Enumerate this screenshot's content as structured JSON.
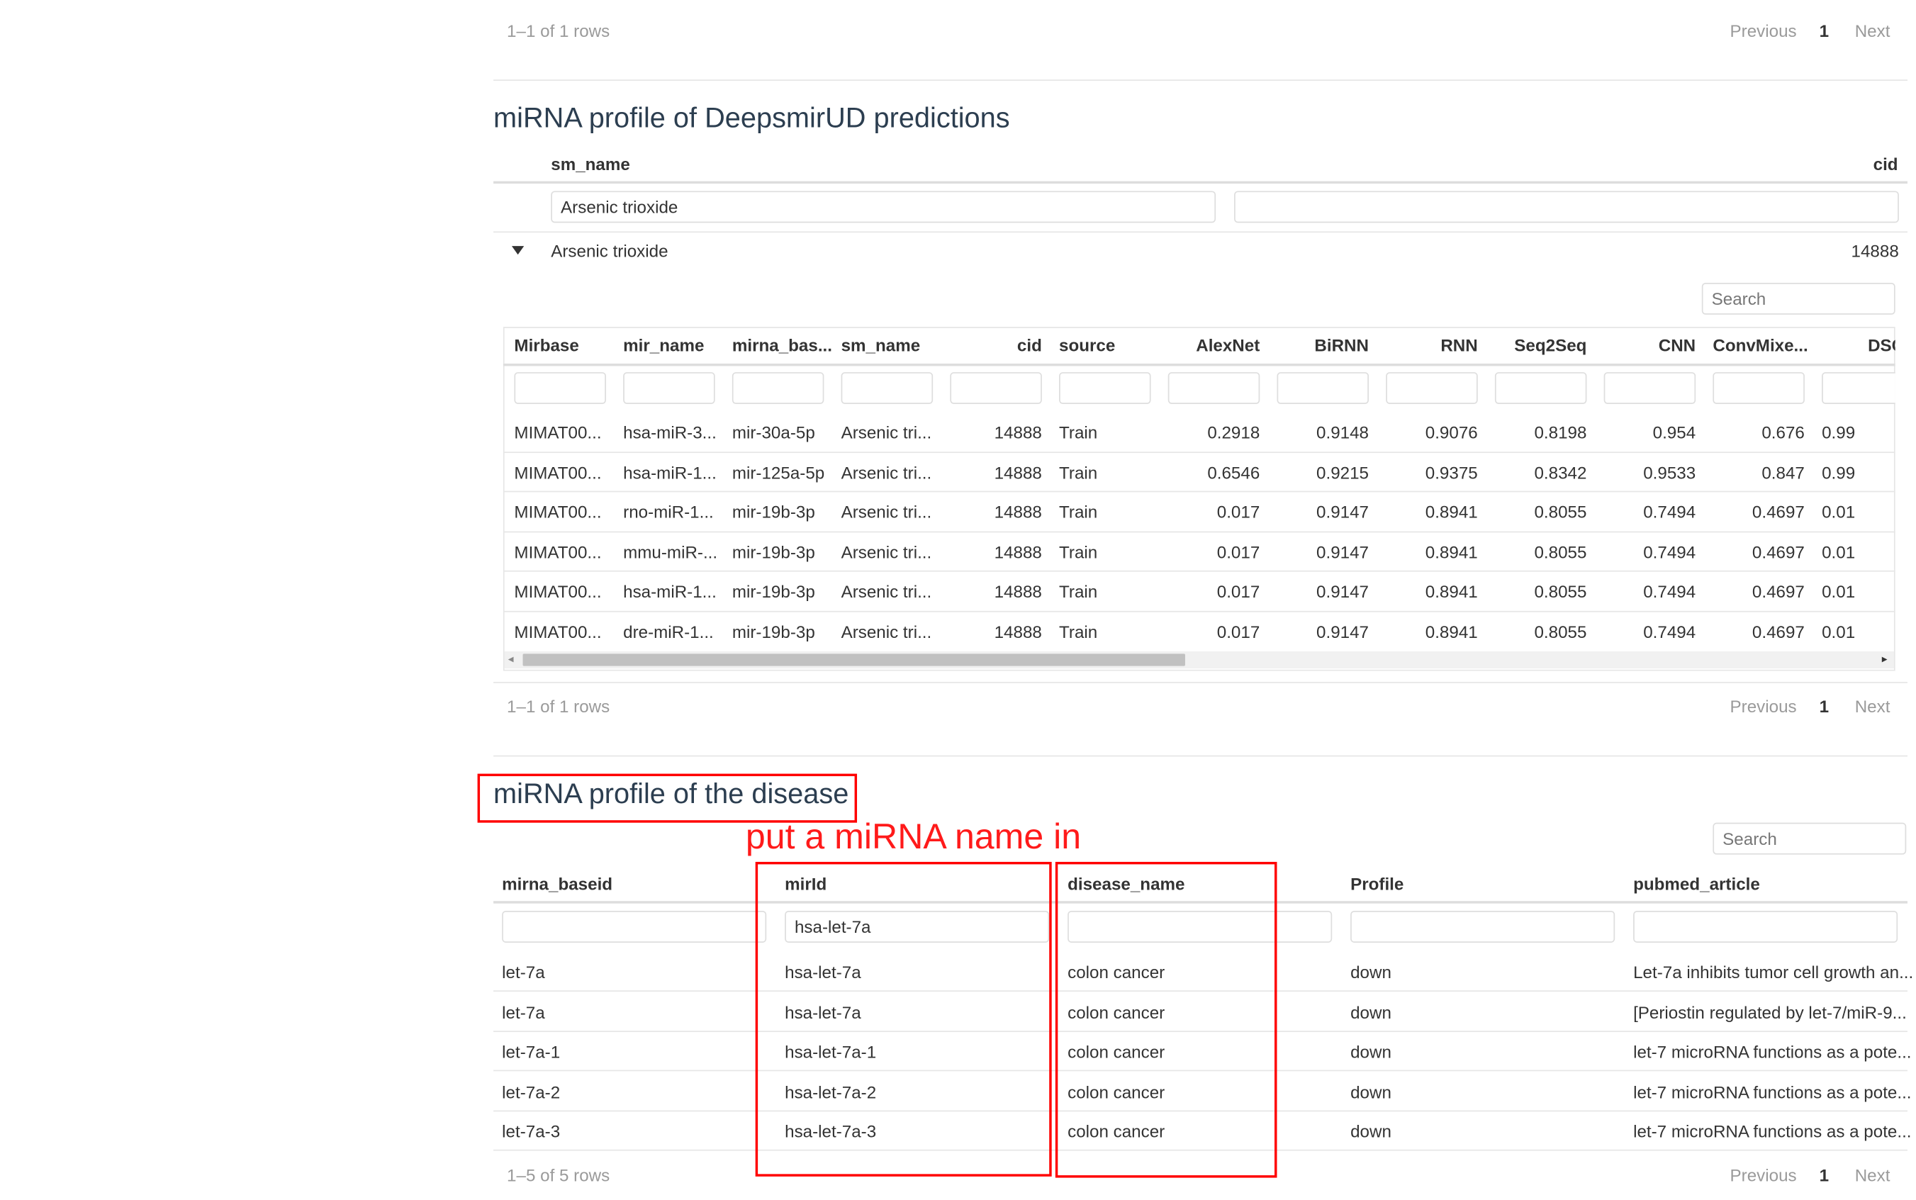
{
  "top_pagination": {
    "rows_text": "1–1 of 1 rows",
    "previous": "Previous",
    "page": "1",
    "next": "Next"
  },
  "deepsmirud": {
    "title": "miRNA profile of DeepsmirUD predictions",
    "outer_headers": {
      "sm_name": "sm_name",
      "cid": "cid"
    },
    "outer_filter": {
      "sm_name_value": "Arsenic trioxide",
      "cid_value": ""
    },
    "outer_row": {
      "expand_icon": "triangle-down",
      "sm_name": "Arsenic trioxide",
      "cid": "14888"
    },
    "search_placeholder": "Search",
    "inner_headers": [
      "Mirbase",
      "mir_name",
      "mirna_bas...",
      "sm_name",
      "cid",
      "source",
      "AlexNet",
      "BiRNN",
      "RNN",
      "Seq2Seq",
      "CNN",
      "ConvMixe...",
      "DSCc"
    ],
    "inner_rows": [
      [
        "MIMAT00...",
        "hsa-miR-3...",
        "mir-30a-5p",
        "Arsenic tri...",
        "14888",
        "Train",
        "0.2918",
        "0.9148",
        "0.9076",
        "0.8198",
        "0.954",
        "0.676",
        "0.99"
      ],
      [
        "MIMAT00...",
        "hsa-miR-1...",
        "mir-125a-5p",
        "Arsenic tri...",
        "14888",
        "Train",
        "0.6546",
        "0.9215",
        "0.9375",
        "0.8342",
        "0.9533",
        "0.847",
        "0.99"
      ],
      [
        "MIMAT00...",
        "rno-miR-1...",
        "mir-19b-3p",
        "Arsenic tri...",
        "14888",
        "Train",
        "0.017",
        "0.9147",
        "0.8941",
        "0.8055",
        "0.7494",
        "0.4697",
        "0.01"
      ],
      [
        "MIMAT00...",
        "mmu-miR-...",
        "mir-19b-3p",
        "Arsenic tri...",
        "14888",
        "Train",
        "0.017",
        "0.9147",
        "0.8941",
        "0.8055",
        "0.7494",
        "0.4697",
        "0.01"
      ],
      [
        "MIMAT00...",
        "hsa-miR-1...",
        "mir-19b-3p",
        "Arsenic tri...",
        "14888",
        "Train",
        "0.017",
        "0.9147",
        "0.8941",
        "0.8055",
        "0.7494",
        "0.4697",
        "0.01"
      ],
      [
        "MIMAT00...",
        "dre-miR-1...",
        "mir-19b-3p",
        "Arsenic tri...",
        "14888",
        "Train",
        "0.017",
        "0.9147",
        "0.8941",
        "0.8055",
        "0.7494",
        "0.4697",
        "0.01"
      ]
    ],
    "scrollbar": {
      "left_arrow": "◂",
      "right_arrow": "▸"
    },
    "pagination": {
      "rows_text": "1–1 of 1 rows",
      "previous": "Previous",
      "page": "1",
      "next": "Next"
    }
  },
  "disease": {
    "title": "miRNA profile of the disease",
    "annotation": "put a miRNA name in",
    "search_placeholder": "Search",
    "headers": [
      "mirna_baseid",
      "mirId",
      "disease_name",
      "Profile",
      "pubmed_article"
    ],
    "filters": [
      "",
      "hsa-let-7a",
      "",
      "",
      ""
    ],
    "rows": [
      [
        "let-7a",
        "hsa-let-7a",
        "colon cancer",
        "down",
        "Let-7a inhibits tumor cell growth an..."
      ],
      [
        "let-7a",
        "hsa-let-7a",
        "colon cancer",
        "down",
        "[Periostin regulated by let-7/miR-9..."
      ],
      [
        "let-7a-1",
        "hsa-let-7a-1",
        "colon cancer",
        "down",
        "let-7 microRNA functions as a pote..."
      ],
      [
        "let-7a-2",
        "hsa-let-7a-2",
        "colon cancer",
        "down",
        "let-7 microRNA functions as a pote..."
      ],
      [
        "let-7a-3",
        "hsa-let-7a-3",
        "colon cancer",
        "down",
        "let-7 microRNA functions as a pote..."
      ]
    ],
    "pagination": {
      "rows_text": "1–5 of 5 rows",
      "previous": "Previous",
      "page": "1",
      "next": "Next"
    }
  },
  "colors": {
    "annotation": "#ff0000",
    "title": "#2c3e50",
    "muted": "#9a9a9a"
  }
}
